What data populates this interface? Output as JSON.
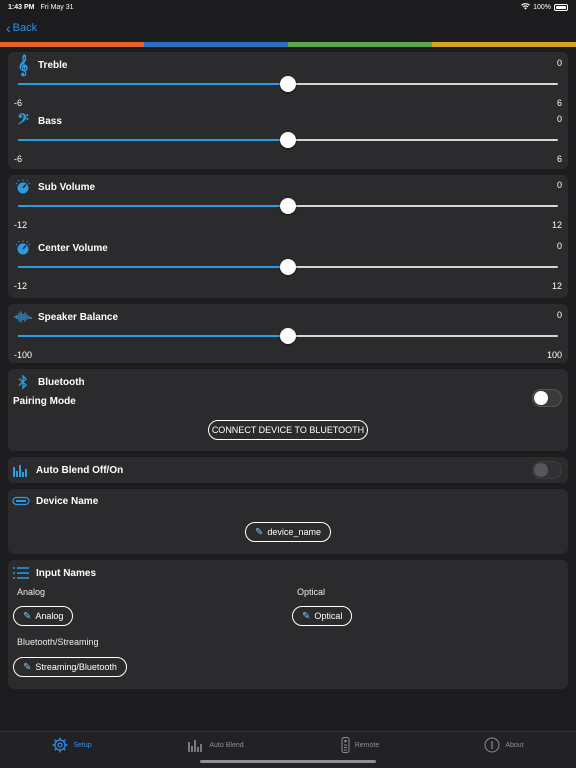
{
  "status": {
    "time": "1:43 PM",
    "date": "Fri May 31",
    "battery": "100%"
  },
  "nav": {
    "back_label": "Back"
  },
  "colors": {
    "strip": [
      "#e5632a",
      "#2b6fbf",
      "#5ba946",
      "#d9a02a"
    ],
    "accent": "#2d9bdf"
  },
  "eq": {
    "treble": {
      "label": "Treble",
      "value": "0",
      "min": "-6",
      "max": "6",
      "fraction": 0.5
    },
    "bass": {
      "label": "Bass",
      "value": "0",
      "min": "-6",
      "max": "6",
      "fraction": 0.5
    }
  },
  "volumes": {
    "sub": {
      "label": "Sub Volume",
      "value": "0",
      "min": "-12",
      "max": "12",
      "fraction": 0.5
    },
    "center": {
      "label": "Center Volume",
      "value": "0",
      "min": "-12",
      "max": "12",
      "fraction": 0.5
    }
  },
  "balance": {
    "label": "Speaker Balance",
    "value": "0",
    "min": "-100",
    "max": "100",
    "fraction": 0.5
  },
  "bluetooth": {
    "label": "Bluetooth",
    "pairing_label": "Pairing Mode",
    "pairing_on": false,
    "connect_button": "CONNECT DEVICE TO BLUETOOTH"
  },
  "auto_blend": {
    "label": "Auto Blend Off/On",
    "enabled": false
  },
  "device": {
    "label": "Device Name",
    "value": "device_name"
  },
  "inputs": {
    "label": "Input Names",
    "analog_label": "Analog",
    "analog_value": "Analog",
    "optical_label": "Optical",
    "optical_value": "Optical",
    "bt_label": "Bluetooth/Streaming",
    "bt_value": "Streaming/Bluetooth"
  },
  "tabs": [
    {
      "label": "Setup",
      "icon": "gear-icon",
      "active": true
    },
    {
      "label": "Auto Blend",
      "icon": "bars-icon",
      "active": false
    },
    {
      "label": "Remote",
      "icon": "remote-icon",
      "active": false
    },
    {
      "label": "About",
      "icon": "info-icon",
      "active": false
    }
  ]
}
